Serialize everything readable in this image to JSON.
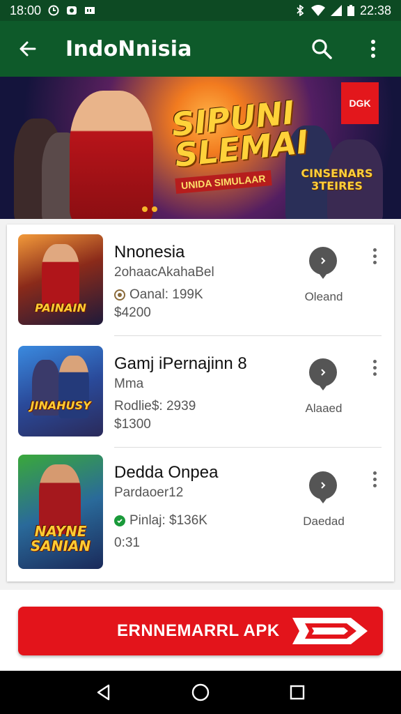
{
  "status_bar": {
    "time_left": "18:00",
    "time_right": "22:38"
  },
  "app_bar": {
    "title": "IndoNnisia",
    "back_icon": "arrow-left-icon",
    "search_icon": "search-icon",
    "menu_icon": "more-vertical-icon"
  },
  "banner": {
    "title": "SIPUNI SLEMAI",
    "subtitle": "UNIDA SIMULAAR",
    "badge": "DGK",
    "logo": "CINSENARS 3TEIRES"
  },
  "items": [
    {
      "title": "Nnonesia",
      "subtitle": "2ohaacAkahaBel",
      "meta": "Oanal: 199K",
      "price": "$4200",
      "action_label": "Oleand",
      "thumb_text": "PAINAIN",
      "meta_icon": "circle-check-icon"
    },
    {
      "title": "Gamj iPernajinn 8",
      "subtitle": "Mma",
      "meta": "Rodlie$: 2939",
      "price": "$1300",
      "action_label": "Alaaed",
      "thumb_text": "JINAHUSY",
      "meta_icon": ""
    },
    {
      "title": "Dedda Onpea",
      "subtitle": "Pardaoer12",
      "meta": "Pinlaj: $136K",
      "price": "0:31",
      "action_label": "Daedad",
      "thumb_text": "NAYNE SANIAN",
      "meta_icon": "check-circle-green-icon"
    }
  ],
  "cta": {
    "label": "ERNNEMARRL APK"
  },
  "colors": {
    "status_bar": "#0d4a23",
    "app_bar": "#0e5a2a",
    "cta": "#e3141b"
  }
}
